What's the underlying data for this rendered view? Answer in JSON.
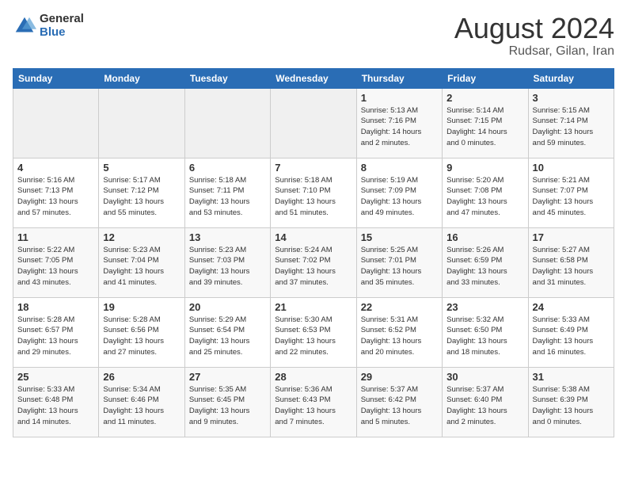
{
  "header": {
    "logo_general": "General",
    "logo_blue": "Blue",
    "month_year": "August 2024",
    "location": "Rudsar, Gilan, Iran"
  },
  "weekdays": [
    "Sunday",
    "Monday",
    "Tuesday",
    "Wednesday",
    "Thursday",
    "Friday",
    "Saturday"
  ],
  "weeks": [
    [
      {
        "day": "",
        "info": ""
      },
      {
        "day": "",
        "info": ""
      },
      {
        "day": "",
        "info": ""
      },
      {
        "day": "",
        "info": ""
      },
      {
        "day": "1",
        "info": "Sunrise: 5:13 AM\nSunset: 7:16 PM\nDaylight: 14 hours\nand 2 minutes."
      },
      {
        "day": "2",
        "info": "Sunrise: 5:14 AM\nSunset: 7:15 PM\nDaylight: 14 hours\nand 0 minutes."
      },
      {
        "day": "3",
        "info": "Sunrise: 5:15 AM\nSunset: 7:14 PM\nDaylight: 13 hours\nand 59 minutes."
      }
    ],
    [
      {
        "day": "4",
        "info": "Sunrise: 5:16 AM\nSunset: 7:13 PM\nDaylight: 13 hours\nand 57 minutes."
      },
      {
        "day": "5",
        "info": "Sunrise: 5:17 AM\nSunset: 7:12 PM\nDaylight: 13 hours\nand 55 minutes."
      },
      {
        "day": "6",
        "info": "Sunrise: 5:18 AM\nSunset: 7:11 PM\nDaylight: 13 hours\nand 53 minutes."
      },
      {
        "day": "7",
        "info": "Sunrise: 5:18 AM\nSunset: 7:10 PM\nDaylight: 13 hours\nand 51 minutes."
      },
      {
        "day": "8",
        "info": "Sunrise: 5:19 AM\nSunset: 7:09 PM\nDaylight: 13 hours\nand 49 minutes."
      },
      {
        "day": "9",
        "info": "Sunrise: 5:20 AM\nSunset: 7:08 PM\nDaylight: 13 hours\nand 47 minutes."
      },
      {
        "day": "10",
        "info": "Sunrise: 5:21 AM\nSunset: 7:07 PM\nDaylight: 13 hours\nand 45 minutes."
      }
    ],
    [
      {
        "day": "11",
        "info": "Sunrise: 5:22 AM\nSunset: 7:05 PM\nDaylight: 13 hours\nand 43 minutes."
      },
      {
        "day": "12",
        "info": "Sunrise: 5:23 AM\nSunset: 7:04 PM\nDaylight: 13 hours\nand 41 minutes."
      },
      {
        "day": "13",
        "info": "Sunrise: 5:23 AM\nSunset: 7:03 PM\nDaylight: 13 hours\nand 39 minutes."
      },
      {
        "day": "14",
        "info": "Sunrise: 5:24 AM\nSunset: 7:02 PM\nDaylight: 13 hours\nand 37 minutes."
      },
      {
        "day": "15",
        "info": "Sunrise: 5:25 AM\nSunset: 7:01 PM\nDaylight: 13 hours\nand 35 minutes."
      },
      {
        "day": "16",
        "info": "Sunrise: 5:26 AM\nSunset: 6:59 PM\nDaylight: 13 hours\nand 33 minutes."
      },
      {
        "day": "17",
        "info": "Sunrise: 5:27 AM\nSunset: 6:58 PM\nDaylight: 13 hours\nand 31 minutes."
      }
    ],
    [
      {
        "day": "18",
        "info": "Sunrise: 5:28 AM\nSunset: 6:57 PM\nDaylight: 13 hours\nand 29 minutes."
      },
      {
        "day": "19",
        "info": "Sunrise: 5:28 AM\nSunset: 6:56 PM\nDaylight: 13 hours\nand 27 minutes."
      },
      {
        "day": "20",
        "info": "Sunrise: 5:29 AM\nSunset: 6:54 PM\nDaylight: 13 hours\nand 25 minutes."
      },
      {
        "day": "21",
        "info": "Sunrise: 5:30 AM\nSunset: 6:53 PM\nDaylight: 13 hours\nand 22 minutes."
      },
      {
        "day": "22",
        "info": "Sunrise: 5:31 AM\nSunset: 6:52 PM\nDaylight: 13 hours\nand 20 minutes."
      },
      {
        "day": "23",
        "info": "Sunrise: 5:32 AM\nSunset: 6:50 PM\nDaylight: 13 hours\nand 18 minutes."
      },
      {
        "day": "24",
        "info": "Sunrise: 5:33 AM\nSunset: 6:49 PM\nDaylight: 13 hours\nand 16 minutes."
      }
    ],
    [
      {
        "day": "25",
        "info": "Sunrise: 5:33 AM\nSunset: 6:48 PM\nDaylight: 13 hours\nand 14 minutes."
      },
      {
        "day": "26",
        "info": "Sunrise: 5:34 AM\nSunset: 6:46 PM\nDaylight: 13 hours\nand 11 minutes."
      },
      {
        "day": "27",
        "info": "Sunrise: 5:35 AM\nSunset: 6:45 PM\nDaylight: 13 hours\nand 9 minutes."
      },
      {
        "day": "28",
        "info": "Sunrise: 5:36 AM\nSunset: 6:43 PM\nDaylight: 13 hours\nand 7 minutes."
      },
      {
        "day": "29",
        "info": "Sunrise: 5:37 AM\nSunset: 6:42 PM\nDaylight: 13 hours\nand 5 minutes."
      },
      {
        "day": "30",
        "info": "Sunrise: 5:37 AM\nSunset: 6:40 PM\nDaylight: 13 hours\nand 2 minutes."
      },
      {
        "day": "31",
        "info": "Sunrise: 5:38 AM\nSunset: 6:39 PM\nDaylight: 13 hours\nand 0 minutes."
      }
    ]
  ]
}
